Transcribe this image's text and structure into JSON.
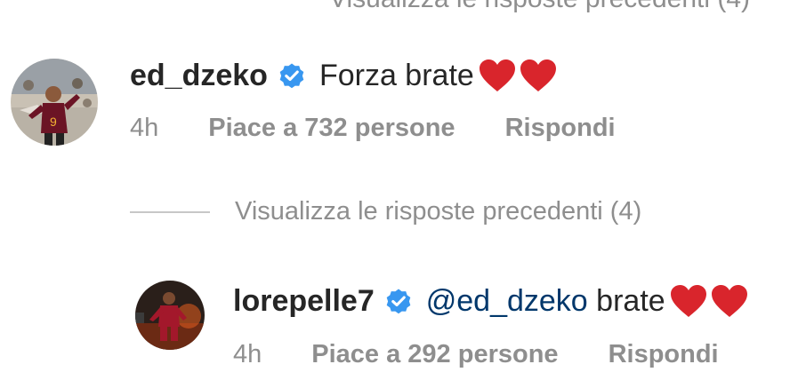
{
  "top_partial_text": "Visualizza le risposte precedenti (4)",
  "comments": [
    {
      "username": "ed_dzeko",
      "text": "Forza brate",
      "mention": "",
      "time": "4h",
      "likes": "Piace a 732 persone",
      "reply": "Rispondi"
    },
    {
      "username": "lorepelle7",
      "mention": "@ed_dzeko",
      "text": " brate",
      "time": "4h",
      "likes": "Piace a 292 persone",
      "reply": "Rispondi"
    }
  ],
  "view_replies": "Visualizza le risposte precedenti (4)",
  "colors": {
    "verified": "#3897f0",
    "heart": "#d9252c",
    "secondary_text": "#8e8e8e",
    "mention": "#00376b"
  },
  "icons": [
    "verified-badge-icon",
    "red-heart-emoji"
  ]
}
